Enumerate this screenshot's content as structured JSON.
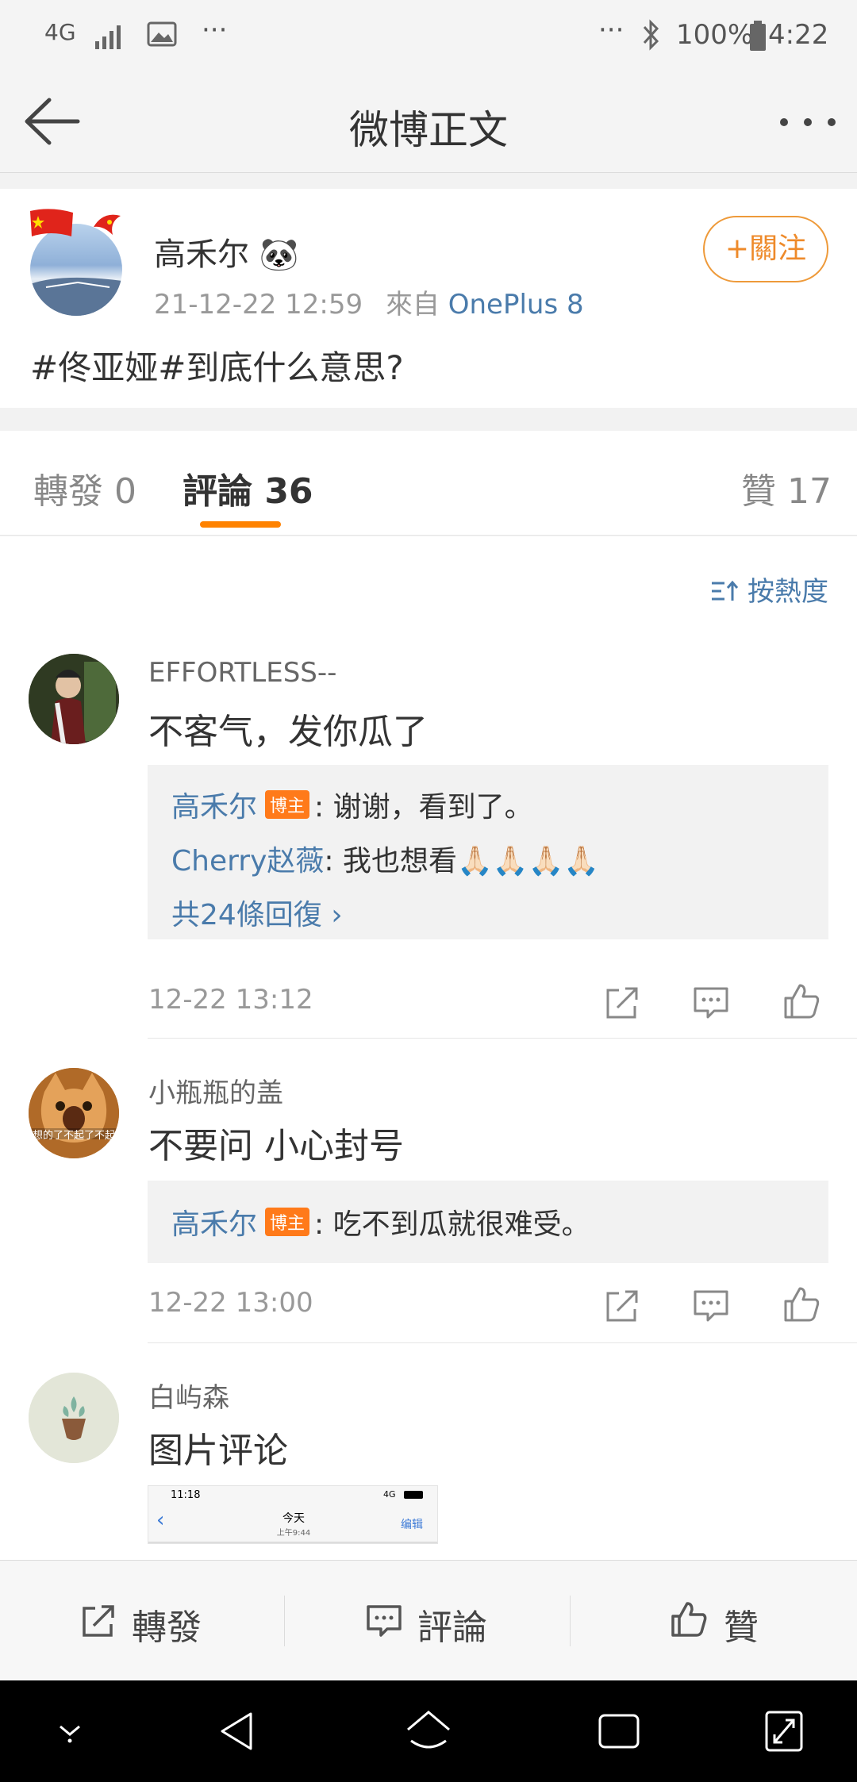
{
  "status_bar": {
    "network": "4G",
    "dots_left": "···",
    "dots_right": "···",
    "battery": "100%",
    "time": "4:22"
  },
  "nav": {
    "title": "微博正文"
  },
  "post": {
    "author": "高禾尔",
    "author_emoji": "🐼",
    "timestamp": "21-12-22 12:59",
    "source_prefix": "來自",
    "device": "OnePlus 8",
    "follow_label": "+關注",
    "text": "#佟亚娅#到底什么意思?"
  },
  "tabs": {
    "repost": "轉發 0",
    "comments": "評論 36",
    "likes": "贊 17"
  },
  "sort_label": "按熱度",
  "comments": [
    {
      "name": "EFFORTLESS--",
      "text": "不客气，发你瓜了",
      "replies": [
        {
          "user": "高禾尔",
          "badge": "博主",
          "text": ": 谢谢，看到了。"
        },
        {
          "user": "Cherry赵薇",
          "badge": "",
          "text": ": 我也想看🙏🏻🙏🏻🙏🏻🙏🏻"
        }
      ],
      "more_replies": "共24條回復 ›",
      "time": "12-22 13:12"
    },
    {
      "name": "小瓶瓶的盖",
      "text": "不要问 小心封号",
      "avatar_text": "想的了不起了不起",
      "replies": [
        {
          "user": "高禾尔",
          "badge": "博主",
          "text": ": 吃不到瓜就很难受。"
        }
      ],
      "time": "12-22 13:00"
    },
    {
      "name": "白屿森",
      "text": "图片评论",
      "image_preview": {
        "time": "11:18",
        "signal": "4G",
        "title": "今天",
        "subtitle": "上午9:44",
        "edit": "编辑",
        "back": "‹"
      }
    }
  ],
  "toolbar": {
    "repost": "轉發",
    "comment": "評論",
    "like": "贊"
  },
  "colors": {
    "accent_orange": "#ff8200",
    "link_blue": "#4a7bab"
  }
}
